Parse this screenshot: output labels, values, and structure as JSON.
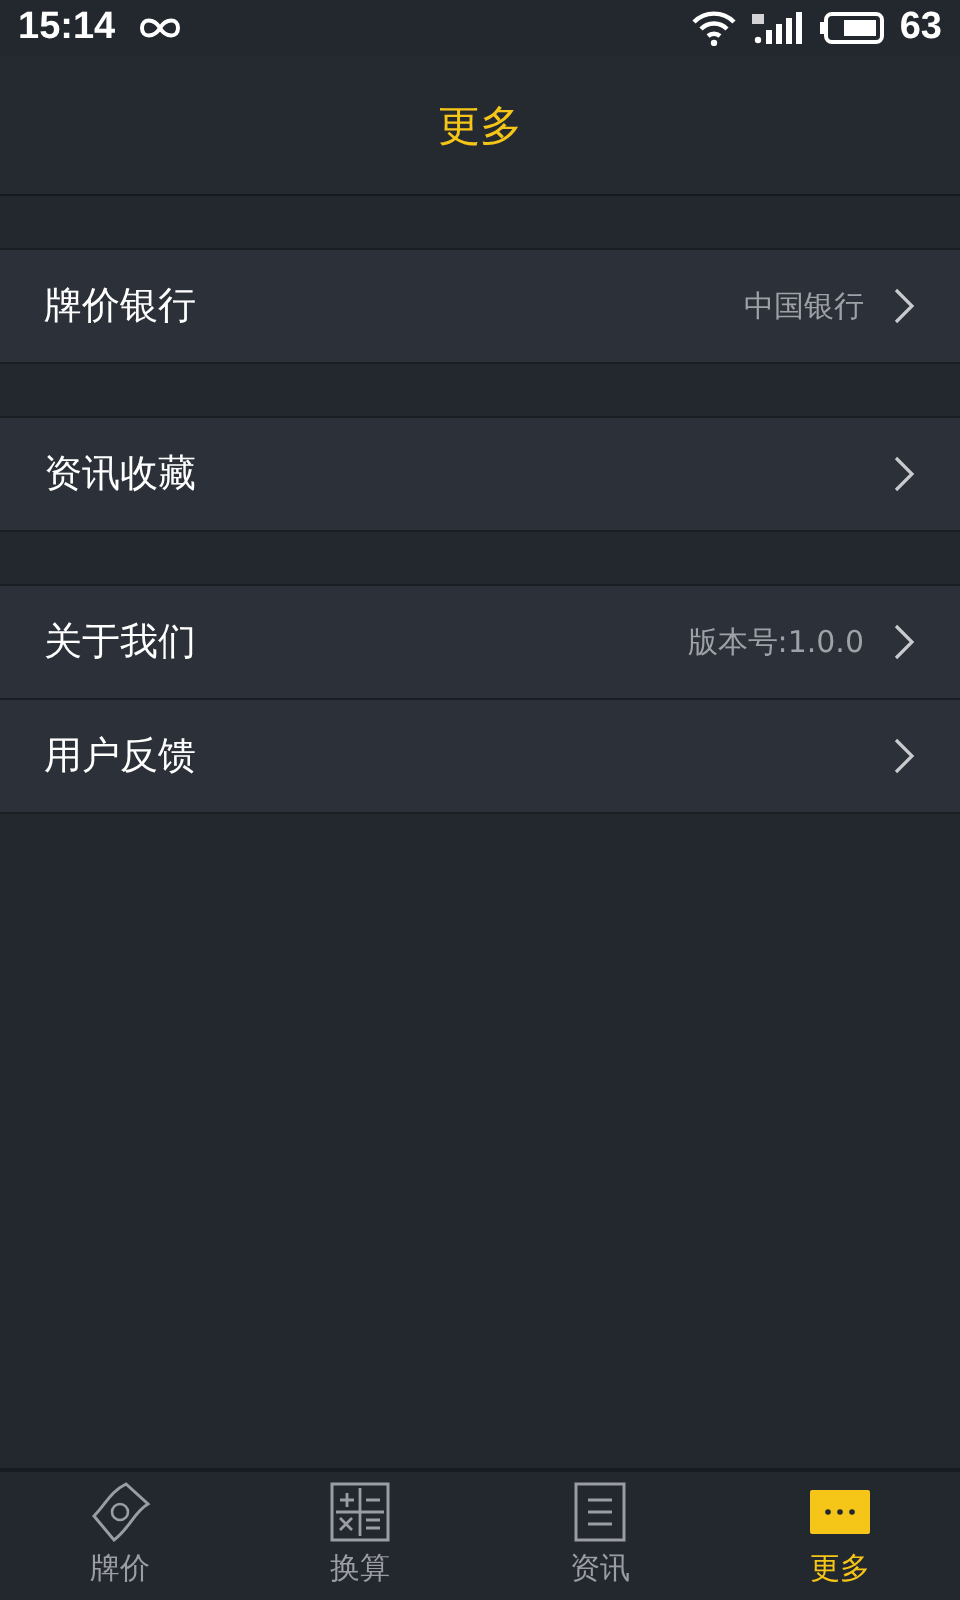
{
  "status_bar": {
    "time": "15:14",
    "battery": "63"
  },
  "header": {
    "title": "更多"
  },
  "groups": [
    {
      "items": [
        {
          "label": "牌价银行",
          "value": "中国银行"
        }
      ]
    },
    {
      "items": [
        {
          "label": "资讯收藏"
        }
      ]
    },
    {
      "items": [
        {
          "label": "关于我们",
          "value": "版本号:1.0.0"
        },
        {
          "label": "用户反馈"
        }
      ]
    }
  ],
  "tabs": [
    {
      "label": "牌价",
      "kind": "banknote",
      "selected": false
    },
    {
      "label": "换算",
      "kind": "calculator",
      "selected": false
    },
    {
      "label": "资讯",
      "kind": "news",
      "selected": false
    },
    {
      "label": "更多",
      "kind": "more",
      "selected": true
    }
  ]
}
